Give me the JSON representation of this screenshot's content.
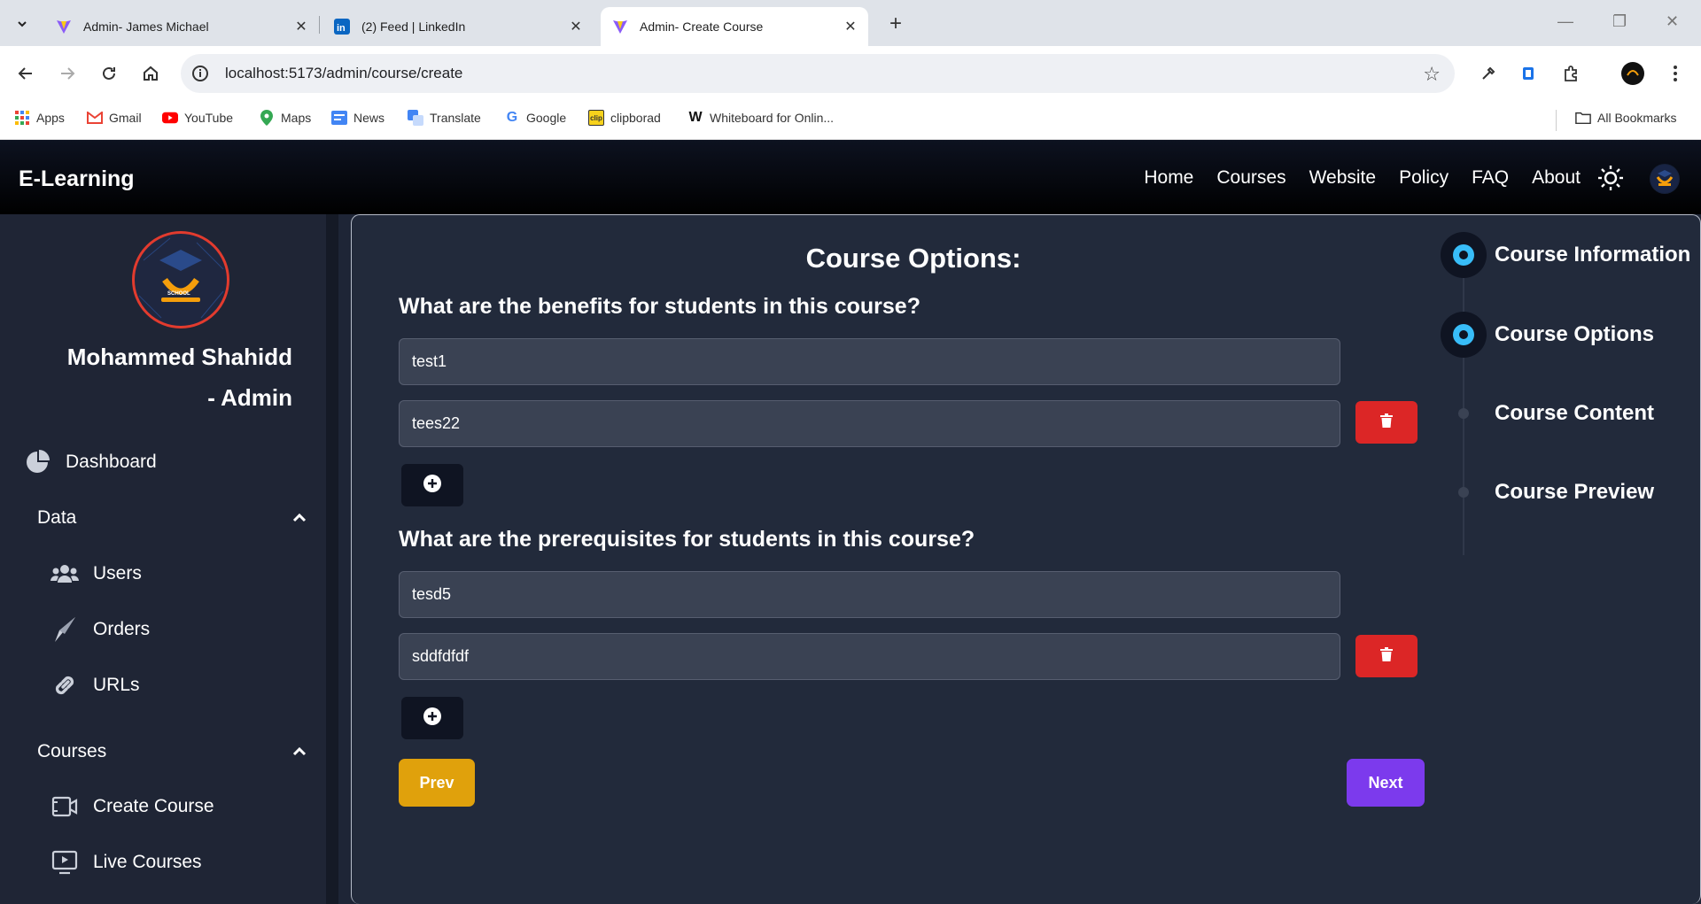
{
  "browser": {
    "tabs": [
      {
        "title": "Admin- James Michael",
        "active": false
      },
      {
        "title": "(2) Feed | LinkedIn",
        "active": false
      },
      {
        "title": "Admin- Create Course",
        "active": true
      }
    ],
    "url": "localhost:5173/admin/course/create",
    "bookmarks": [
      {
        "label": "Apps",
        "icon": "apps-grid-icon"
      },
      {
        "label": "Gmail",
        "icon": "gmail-icon"
      },
      {
        "label": "YouTube",
        "icon": "youtube-icon"
      },
      {
        "label": "Maps",
        "icon": "maps-icon"
      },
      {
        "label": "News",
        "icon": "news-icon"
      },
      {
        "label": "Translate",
        "icon": "translate-icon"
      },
      {
        "label": "Google",
        "icon": "google-icon"
      },
      {
        "label": "clipborad",
        "icon": "clipboard-icon"
      },
      {
        "label": "Whiteboard for Onlin...",
        "icon": "whiteboard-icon"
      }
    ],
    "all_bookmarks": "All Bookmarks"
  },
  "app": {
    "brand": "E-Learning",
    "nav": [
      "Home",
      "Courses",
      "Website",
      "Policy",
      "FAQ",
      "About"
    ]
  },
  "sidebar": {
    "user_name": "Mohammed Shahidd",
    "user_role": "- Admin",
    "dashboard": "Dashboard",
    "data_group": "Data",
    "data_items": [
      "Users",
      "Orders",
      "URLs"
    ],
    "courses_group": "Courses",
    "courses_items": [
      "Create Course",
      "Live Courses"
    ]
  },
  "main": {
    "title": "Course Options:",
    "benefits_question": "What are the benefits for students in this course?",
    "benefits": [
      "test1",
      "tees22"
    ],
    "prereq_question": "What are the prerequisites for students in this course?",
    "prerequisites": [
      "tesd5",
      "sddfdfdf"
    ],
    "prev_label": "Prev",
    "next_label": "Next"
  },
  "steps": [
    {
      "label": "Course Information",
      "active": true
    },
    {
      "label": "Course Options",
      "active": true
    },
    {
      "label": "Course Content",
      "active": false
    },
    {
      "label": "Course Preview",
      "active": false
    }
  ],
  "colors": {
    "delete": "#dc2626",
    "prev": "#e0a10c",
    "next": "#7c3aed",
    "step_active": "#38bdf8"
  }
}
